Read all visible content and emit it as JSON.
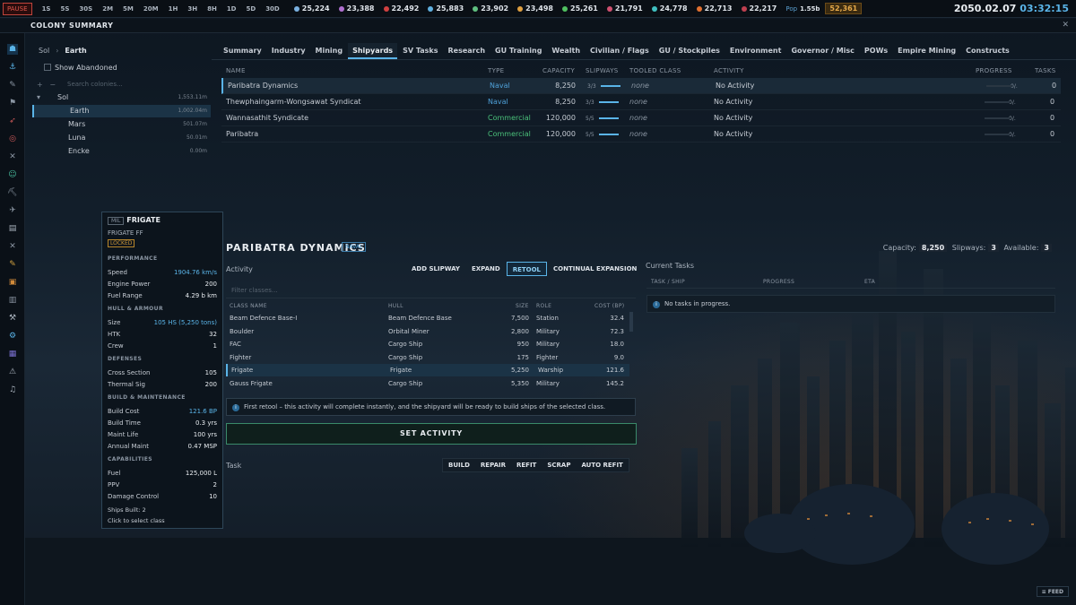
{
  "topbar": {
    "pause": "PAUSE",
    "speeds": [
      "1S",
      "5S",
      "30S",
      "2M",
      "5M",
      "20M",
      "1H",
      "3H",
      "8H",
      "1D",
      "5D",
      "30D"
    ],
    "resources": [
      {
        "value": "25,224",
        "color": "#7ab0e0"
      },
      {
        "value": "23,388",
        "color": "#b070d0"
      },
      {
        "value": "22,492",
        "color": "#d04040"
      },
      {
        "value": "25,883",
        "color": "#60b0e0"
      },
      {
        "value": "23,902",
        "color": "#60c080"
      },
      {
        "value": "23,498",
        "color": "#e0a040"
      },
      {
        "value": "25,261",
        "color": "#50c060"
      },
      {
        "value": "21,791",
        "color": "#d05070"
      },
      {
        "value": "24,778",
        "color": "#40c0c0"
      },
      {
        "value": "22,713",
        "color": "#e07030"
      },
      {
        "value": "22,217",
        "color": "#c04050"
      }
    ],
    "pop_label": "Pop",
    "pop_value": "1.55b",
    "wealth": "52,361",
    "date": "2050.02.07",
    "time": "03:32:15"
  },
  "window": {
    "title": "COLONY SUMMARY",
    "close": "✕"
  },
  "sidebar": {
    "icons": [
      "home-icon",
      "anchor-icon",
      "wrench-icon",
      "flag-icon",
      "rocket-icon",
      "target-icon",
      "crossed-swords-icon",
      "person-icon",
      "pickaxe-icon",
      "satellite-icon",
      "document-icon",
      "cross-icon",
      "tag-icon",
      "box-icon",
      "clipboard-icon",
      "tools-icon",
      "gear-icon",
      "chart-icon",
      "warning-icon",
      "music-icon"
    ]
  },
  "colonies": {
    "breadcrumb_root": "Sol",
    "breadcrumb_sep": "›",
    "breadcrumb_current": "Earth",
    "show_abandoned": "Show Abandoned",
    "expand": "+",
    "collapse": "−",
    "search_placeholder": "Search colonies...",
    "system": {
      "name": "Sol",
      "pop": "1,553.11m",
      "caret": "▾"
    },
    "items": [
      {
        "name": "Earth",
        "pop": "1,002.04m"
      },
      {
        "name": "Mars",
        "pop": "501.07m"
      },
      {
        "name": "Luna",
        "pop": "50.01m"
      },
      {
        "name": "Encke",
        "pop": "0.00m"
      }
    ]
  },
  "tabs": [
    "Summary",
    "Industry",
    "Mining",
    "Shipyards",
    "SV Tasks",
    "Research",
    "GU Training",
    "Wealth",
    "Civilian / Flags",
    "GU / Stockpiles",
    "Environment",
    "Governor / Misc",
    "POWs",
    "Empire Mining",
    "Constructs"
  ],
  "shipyards": {
    "headers": {
      "name": "NAME",
      "type": "TYPE",
      "capacity": "CAPACITY",
      "slipways": "SLIPWAYS",
      "tooled": "TOOLED CLASS",
      "activity": "ACTIVITY",
      "progress": "PROGRESS",
      "tasks": "TASKS"
    },
    "rows": [
      {
        "name": "Paribatra Dynamics",
        "type": "Naval",
        "capacity": "8,250",
        "slipways": "3/3",
        "tooled": "none",
        "activity": "No Activity",
        "progress": "0/.",
        "tasks": "0"
      },
      {
        "name": "Thewphaingarm-Wongsawat Syndicat",
        "type": "Naval",
        "capacity": "8,250",
        "slipways": "3/3",
        "tooled": "none",
        "activity": "No Activity",
        "progress": "0/.",
        "tasks": "0"
      },
      {
        "name": "Wannasathit Syndicate",
        "type": "Commercial",
        "capacity": "120,000",
        "slipways": "5/5",
        "tooled": "none",
        "activity": "No Activity",
        "progress": "0/.",
        "tasks": "0"
      },
      {
        "name": "Paribatra",
        "type": "Commercial",
        "capacity": "120,000",
        "slipways": "5/5",
        "tooled": "none",
        "activity": "No Activity",
        "progress": "0/.",
        "tasks": "0"
      }
    ]
  },
  "tooltip": {
    "mil": "MIL",
    "title": "FRIGATE",
    "subtitle": "FRIGATE FF",
    "locked": "LOCKED",
    "sections": {
      "performance": "PERFORMANCE",
      "hull": "HULL & ARMOUR",
      "defenses": "DEFENSES",
      "build": "BUILD & MAINTENANCE",
      "capabilities": "CAPABILITIES"
    },
    "speed": {
      "label": "Speed",
      "value": "1904.76 km/s"
    },
    "engine": {
      "label": "Engine Power",
      "value": "200"
    },
    "fuel_range": {
      "label": "Fuel Range",
      "value": "4.29 b km"
    },
    "size": {
      "label": "Size",
      "value": "105 HS (5,250 tons)"
    },
    "htk": {
      "label": "HTK",
      "value": "32"
    },
    "crew": {
      "label": "Crew",
      "value": "1"
    },
    "cross": {
      "label": "Cross Section",
      "value": "105"
    },
    "thermal": {
      "label": "Thermal Sig",
      "value": "200"
    },
    "build_cost": {
      "label": "Build Cost",
      "value": "121.6 BP"
    },
    "build_time": {
      "label": "Build Time",
      "value": "0.3 yrs"
    },
    "maint_life": {
      "label": "Maint Life",
      "value": "100 yrs"
    },
    "annual": {
      "label": "Annual Maint",
      "value": "0.47 MSP"
    },
    "fuel": {
      "label": "Fuel",
      "value": "125,000 L"
    },
    "ppv": {
      "label": "PPV",
      "value": "2"
    },
    "damage": {
      "label": "Damage Control",
      "value": "10"
    },
    "ships_built": "Ships Built: 2",
    "hint": "Click to select class"
  },
  "detail": {
    "title": "PARIBATRA DYNAMICS",
    "badge": "NAVAL",
    "capacity_label": "Capacity:",
    "capacity": "8,250",
    "slipways_label": "Slipways:",
    "slipways": "3",
    "available_label": "Available:",
    "available": "3",
    "activity_label": "Activity",
    "buttons": [
      "ADD SLIPWAY",
      "EXPAND",
      "RETOOL",
      "CONTINUAL EXPANSION"
    ],
    "filter_placeholder": "Filter classes...",
    "class_headers": {
      "name": "CLASS NAME",
      "hull": "HULL",
      "size": "SIZE",
      "role": "ROLE",
      "cost": "COST (BP)"
    },
    "classes": [
      {
        "name": "Beam Defence Base-I",
        "hull": "Beam Defence Base",
        "size": "7,500",
        "role": "Station",
        "cost": "32.4"
      },
      {
        "name": "Boulder",
        "hull": "Orbital Miner",
        "size": "2,800",
        "role": "Military",
        "cost": "72.3"
      },
      {
        "name": "FAC",
        "hull": "Cargo Ship",
        "size": "950",
        "role": "Military",
        "cost": "18.0"
      },
      {
        "name": "Fighter",
        "hull": "Cargo Ship",
        "size": "175",
        "role": "Fighter",
        "cost": "9.0"
      },
      {
        "name": "Frigate",
        "hull": "Frigate",
        "size": "5,250",
        "role": "Warship",
        "cost": "121.6"
      },
      {
        "name": "Gauss Frigate",
        "hull": "Cargo Ship",
        "size": "5,350",
        "role": "Military",
        "cost": "145.2"
      }
    ],
    "info": "First retool – this activity will complete instantly, and the shipyard will be ready to build ships of the selected class.",
    "info_icon": "i",
    "set_activity": "SET ACTIVITY",
    "task_label": "Task",
    "task_buttons": [
      "BUILD",
      "REPAIR",
      "REFIT",
      "SCRAP",
      "AUTO REFIT"
    ]
  },
  "current_tasks": {
    "title": "Current Tasks",
    "headers": {
      "task": "TASK / SHIP",
      "progress": "PROGRESS",
      "eta": "ETA"
    },
    "empty": "No tasks in progress.",
    "empty_icon": "i"
  },
  "feed": "FEED"
}
